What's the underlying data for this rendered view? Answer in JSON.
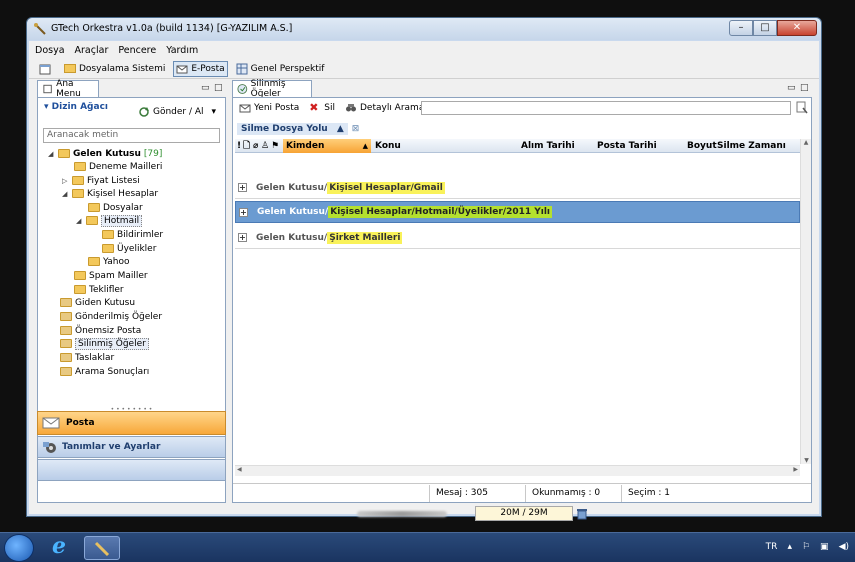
{
  "window": {
    "title": "GTech Orkestra v1.0a (build 1134) [G-YAZILIM A.S.]"
  },
  "menu": [
    "Dosya",
    "Araçlar",
    "Pencere",
    "Yardım"
  ],
  "toolbar": {
    "dosyalama": "Dosyalama Sistemi",
    "eposta": "E-Posta",
    "genel": "Genel Perspektif"
  },
  "left": {
    "tab": "Ana Menu",
    "section": "Dizin Ağacı",
    "gonder": "Gönder / Al",
    "search_placeholder": "Aranacak metin",
    "tree": [
      {
        "label": "Gelen Kutusu",
        "count": "[79]"
      },
      {
        "label": "Deneme Mailleri"
      },
      {
        "label": "Fiyat Listesi"
      },
      {
        "label": "Kişisel Hesaplar"
      },
      {
        "label": "Dosyalar"
      },
      {
        "label": "Hotmail"
      },
      {
        "label": "Bildirimler"
      },
      {
        "label": "Üyelikler"
      },
      {
        "label": "Yahoo"
      },
      {
        "label": "Spam Mailler"
      },
      {
        "label": "Teklifler"
      },
      {
        "label": "Giden Kutusu"
      },
      {
        "label": "Gönderilmiş Öğeler"
      },
      {
        "label": "Önemsiz Posta"
      },
      {
        "label": "Silinmiş Öğeler"
      },
      {
        "label": "Taslaklar"
      },
      {
        "label": "Arama Sonuçları"
      }
    ],
    "nav": {
      "posta": "Posta",
      "tanim": "Tanımlar ve Ayarlar"
    }
  },
  "right": {
    "tab": "Silinmiş Öğeler",
    "yeni": "Yeni Posta",
    "sil": "Sil",
    "detayli": "Detaylı Arama",
    "filter": "Silme Dosya Yolu",
    "columns": {
      "kimden": "Kimden",
      "konu": "Konu",
      "alim": "Alım Tarihi",
      "posta": "Posta Tarihi",
      "boyut": "Boyut",
      "silme": "Silme Zamanı"
    },
    "groups": [
      {
        "prefix": "Gelen Kutusu/",
        "path": "Kişisel Hesaplar/Gmail"
      },
      {
        "prefix": "Gelen Kutusu/",
        "path": "Kişisel Hesaplar/Hotmail/Üyelikler/2011 Yılı"
      },
      {
        "prefix": "Gelen Kutusu/",
        "path": "Şirket Mailleri"
      }
    ],
    "status": {
      "mesaj": "Mesaj : 305",
      "okunmamis": "Okunmamış : 0",
      "secim": "Seçim : 1"
    }
  },
  "bottom": {
    "memory": "20M / 29M"
  },
  "taskbar": {
    "lang": "TR"
  }
}
